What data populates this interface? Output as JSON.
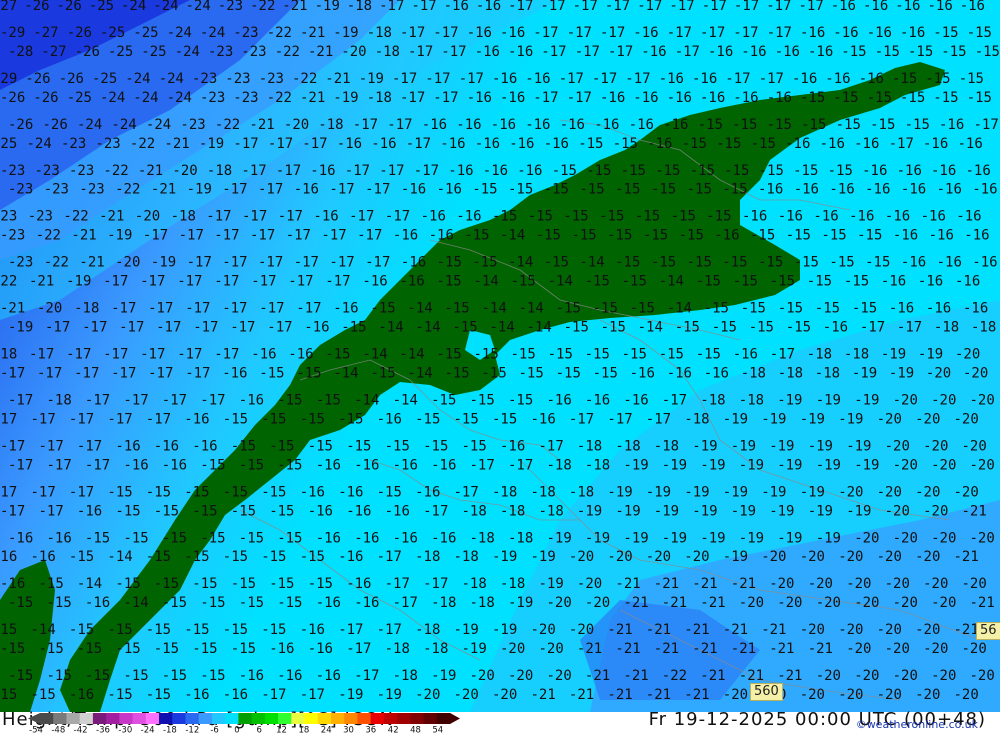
{
  "title": {
    "left": "Height/Temp. 500 hPa [gdmp][°C] ICON",
    "right": "Fr 19-12-2025 00:00 UTC (00+48)"
  },
  "credit": "©weatheronline.co.uk",
  "badges": [
    "560",
    "56"
  ],
  "legend": {
    "ticks": [
      "-54",
      "-48",
      "-42",
      "-36",
      "-30",
      "-24",
      "-18",
      "-12",
      "-6",
      "0",
      "6",
      "12",
      "18",
      "24",
      "30",
      "36",
      "42",
      "48",
      "54"
    ],
    "colors": [
      "#4a4a4a",
      "#7a7a7a",
      "#a8a8a8",
      "#d0d0d0",
      "#7a1a7a",
      "#a020a0",
      "#c838c8",
      "#e050e0",
      "#ff70ff",
      "#1010b0",
      "#1a3ae0",
      "#2a6af0",
      "#3a9aff",
      "#20c8ff",
      "#00e0ff",
      "#00a000",
      "#00c000",
      "#00e000",
      "#30ff30",
      "#e8ff40",
      "#ffff00",
      "#ffd800",
      "#ffb000",
      "#ff8800",
      "#ff5000",
      "#e80000",
      "#c00000",
      "#a00000",
      "#800000",
      "#600000",
      "#400000"
    ]
  },
  "map": {
    "temperature_colors": {
      "-27": "#1a3ae0",
      "-24": "#2a6af0",
      "-21": "#3a9aff",
      "-18": "#20c8ff",
      "-16": "#00e0ff",
      "-14": "#006400"
    },
    "rows": [
      "27 26 26 25 24 24 24 23 22 21 19 18 17 17 16 16 17 17 17 17 17 17 17 17 17 17 16 16 16 16 16",
      "29 27 26 25 25 24 24 23 22 21 19 18 17 17 16 16 17 17 17 16 17 17 17 17 16 16 16 16 15 15",
      "28 27 26 25 25 24 23 23 22 21 20 18 17 17 16 16 17 17 17 16 17 16 16 16 16 15 15 15 15 15",
      "29 26 26 25 24 24 23 23 23 22 21 19 17 17 17 16 16 17 17 17 16 16 17 17 16 16 16 15 15 15",
      "26 26 25 24 24 24 23 23 22 21 19 18 17 17 16 16 17 17 16 16 16 16 16 16 15 15 15 15 15 15",
      "26 26 24 24 24 23 22 21 20 18 17 17 16 16 16 16 16 16 16 16 15 15 15 15 15 15 15 16 17",
      "25 24 23 23 22 21 19 17 17 17 16 16 17 16 16 16 16 15 15 16 15 15 15 16 16 16 17 16 16",
      "23 23 23 22 21 20 18 17 17 16 17 17 17 16 16 16 15 15 15 15 15 15 15 15 15 16 16 16 16",
      "23 23 23 22 21 19 17 17 16 17 17 16 16 15 15 15 15 15 15 15 15 16 16 16 16 16 16 16",
      "23 23 22 21 20 18 17 17 17 16 17 17 16 16 15 15 15 15 15 15 15 16 16 16 16 16 16 16",
      "23 22 21 19 17 17 17 17 17 17 17 16 16 15 14 15 15 15 15 15 16 15 15 15 15 16 16 16",
      "23 22 21 20 19 17 17 17 17 17 17 16 15 15 14 15 14 15 15 15 15 15 15 15 15 16 16 16",
      "22 21 19 17 17 17 17 17 17 17 16 16 15 14 15 14 15 15 14 15 15 15 15 15 16 16 16",
      "21 20 18 17 17 17 17 17 17 16 15 14 15 14 14 15 15 15 14 15 15 15 15 15 16 16 16",
      "19 17 17 17 17 17 17 17 16 15 14 14 15 14 14 15 15 14 15 15 15 15 16 17 17 18 18",
      "18 17 17 17 17 17 17 16 16 15 14 14 15 15 15 15 15 15 15 15 16 17 18 18 19 19 20",
      "17 17 17 17 17 17 16 15 15 14 15 14 15 15 15 15 15 16 16 16 18 18 18 19 19 20 20",
      "17 18 17 17 17 17 16 15 15 14 14 15 15 15 16 16 16 17 18 18 19 19 19 20 20 20",
      "17 17 17 17 17 16 15 15 15 15 16 15 15 15 16 17 17 17 18 19 19 19 19 20 20 20",
      "17 17 17 16 16 16 15 15 15 15 15 15 15 16 17 18 18 18 19 19 19 19 19 20 20 20",
      "17 17 17 16 16 15 15 15 16 16 16 16 17 17 18 18 19 19 19 19 19 19 19 20 20 20",
      "17 17 17 15 15 15 15 15 16 16 15 16 17 18 18 18 19 19 19 19 19 19 20 20 20 20",
      "17 17 16 15 15 15 15 15 16 16 16 17 18 18 18 19 19 19 19 19 19 19 19 20 20 21",
      "16 16 15 15 15 15 15 15 16 16 16 16 18 18 19 19 19 19 19 19 19 19 20 20 20 20",
      "16 16 15 14 15 15 15 15 15 16 17 18 18 19 19 20 20 20 20 19 20 20 20 20 20 21",
      "16 15 14 15 15 15 15 15 15 16 17 17 18 18 19 20 21 21 21 21 20 20 20 20 20 20",
      "15 15 16 14 15 15 15 15 16 16 17 18 18 19 20 20 21 21 21 20 20 20 20 20 20 21",
      "15 14 15 15 15 15 15 15 16 17 17 18 19 19 20 20 21 21 21 21 21 20 20 20 20 21",
      "15 15 15 15 15 15 15 16 16 17 18 18 19 20 20 21 21 21 21 21 21 21 20 20 20 20",
      "15 15 15 15 15 15 16 16 16 17 18 19 20 20 20 21 21 22 21 21 21 20 20 20 20 20",
      "15 15 16 15 15 16 16 17 17 19 19 20 20 20 21 21 21 21 21 20 20 20 20 20 20 20"
    ]
  }
}
